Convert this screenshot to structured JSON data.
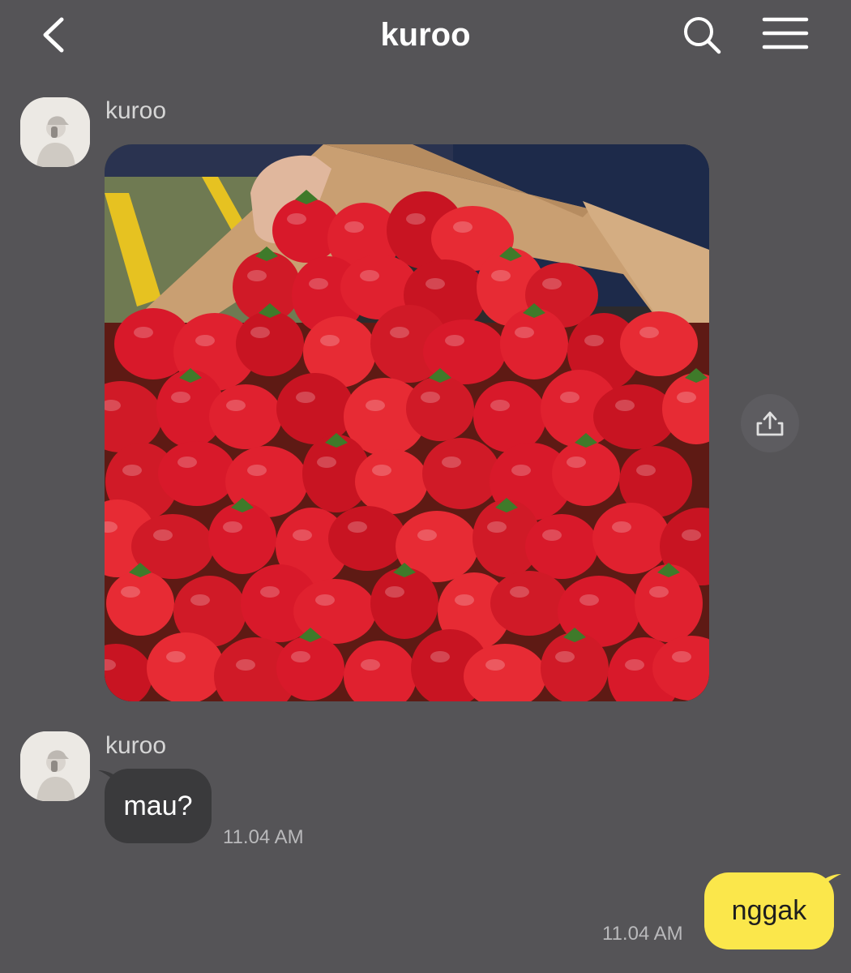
{
  "header": {
    "title": "kuroo",
    "back_icon": "chevron-left-icon",
    "search_icon": "search-icon",
    "menu_icon": "hamburger-menu-icon"
  },
  "messages": [
    {
      "type": "image",
      "sender": "kuroo",
      "image_description_icon": "photo-of-strawberries",
      "share_icon": "share-icon"
    },
    {
      "type": "text",
      "sender": "kuroo",
      "text": "mau?",
      "time": "11.04 AM"
    },
    {
      "type": "text",
      "sender": "me",
      "text": "nggak",
      "time": "11.04 AM"
    }
  ],
  "colors": {
    "background": "#555457",
    "incoming_bubble": "#3a3a3c",
    "outgoing_bubble": "#fbe74b",
    "strawberry_red": "#d8192a"
  }
}
